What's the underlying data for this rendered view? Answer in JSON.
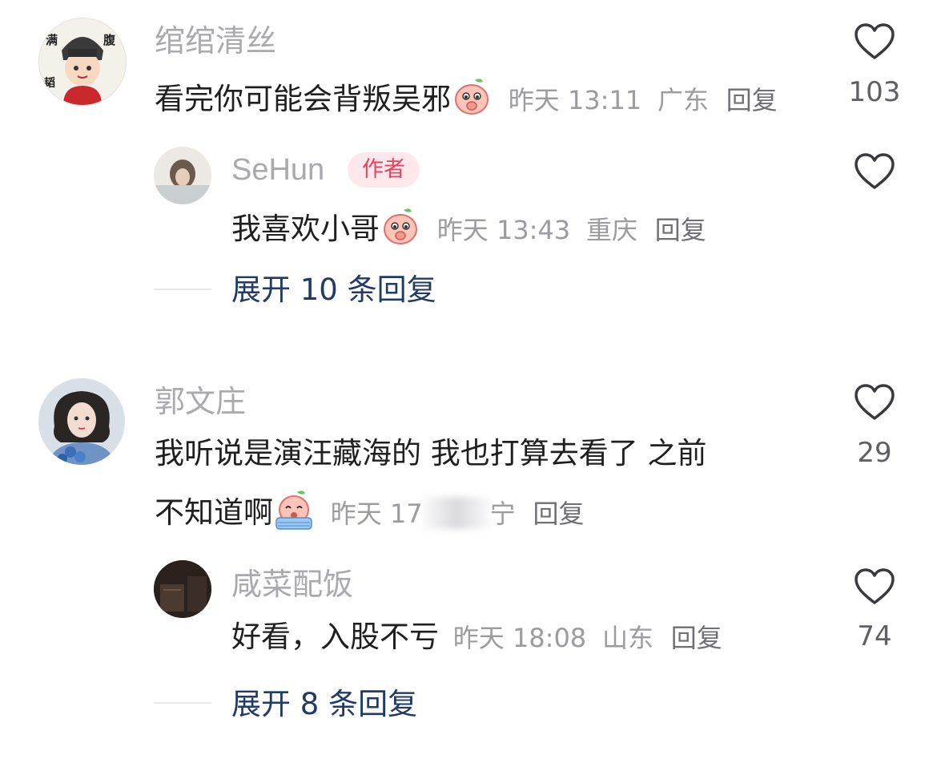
{
  "comments": [
    {
      "username": "绾绾清丝",
      "avatar_text": {
        "tl": "满",
        "tr": "腹",
        "bl": "韬"
      },
      "text": "看完你可能会背叛吴邪",
      "emoji": "blush-peach-emoji",
      "time": "昨天 13:11",
      "location": "广东",
      "reply_label": "回复",
      "likes": "103",
      "replies": [
        {
          "username": "SeHun",
          "badge": "作者",
          "text": "我喜欢小哥",
          "emoji": "blush-peach-emoji",
          "time": "昨天 13:43",
          "location": "重庆",
          "reply_label": "回复"
        }
      ],
      "expand_label": "展开 10 条回复"
    },
    {
      "username": "郭文庄",
      "text_line1": "我听说是演汪藏海的  我也打算去看了  之前",
      "text_line2": "不知道啊",
      "emoji": "crying-peach-emoji",
      "time_partial": "昨天 17",
      "location_partial": "宁",
      "reply_label": "回复",
      "likes": "29",
      "replies": [
        {
          "username": "咸菜配饭",
          "text": "好看，入股不亏",
          "time": "昨天 18:08",
          "location": "山东",
          "reply_label": "回复",
          "likes": "74"
        }
      ],
      "expand_label": "展开 8 条回复"
    }
  ],
  "colors": {
    "username": "#a9a9ae",
    "body_text": "#1f1f1f",
    "meta_text": "#9b9ba0",
    "expand_link": "#223a66",
    "author_badge_bg": "#ffe8ec",
    "author_badge_text": "#ee3f5b"
  }
}
